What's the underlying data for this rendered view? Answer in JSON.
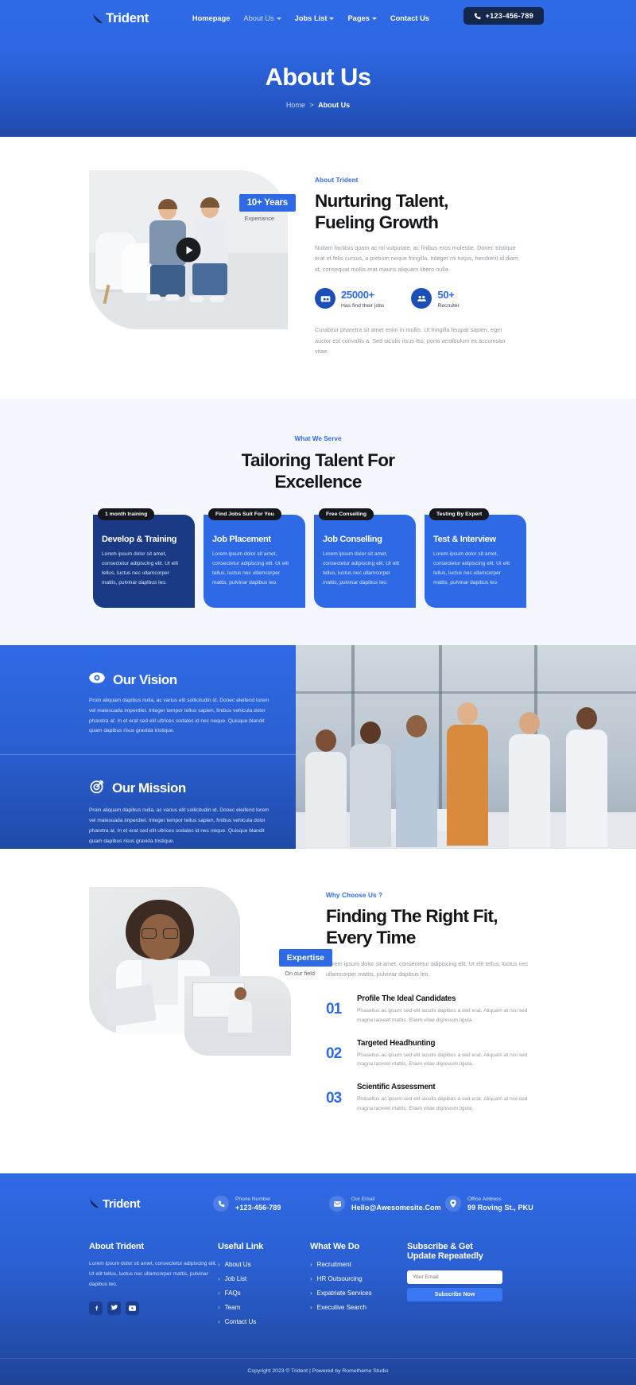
{
  "brand": {
    "name": "Trident"
  },
  "nav": {
    "items": [
      {
        "label": "Homepage",
        "caret": false,
        "active": true
      },
      {
        "label": "About Us",
        "caret": true,
        "active": false
      },
      {
        "label": "Jobs List",
        "caret": true,
        "active": false
      },
      {
        "label": "Pages",
        "caret": true,
        "active": false
      },
      {
        "label": "Contact Us",
        "caret": false,
        "active": false
      }
    ],
    "phone_button": "+123-456-789"
  },
  "hero": {
    "title": "About Us",
    "breadcrumb_home": "Home",
    "breadcrumb_sep": ">",
    "breadcrumb_current": "About Us"
  },
  "about": {
    "badge_years": "10+ Years",
    "badge_sub": "Experiance",
    "eyebrow": "About Trident",
    "title": "Nurturing Talent,\nFueling Growth",
    "paragraph": "Nullam facilisis quam ac mi vulputate, ac finibus eros molestie. Donec tristique erat et felis cursus, a pretium neque fringilla. Integer mi turpis, hendrerit id diam id, consequat mollis erat mauris aliquam libero nulla.",
    "stats": [
      {
        "number": "25000+",
        "label": "Has find their jobs",
        "icon": "handshake-icon"
      },
      {
        "number": "50+",
        "label": "Recruiter",
        "icon": "people-icon"
      }
    ],
    "paragraph2": "Curabitur pharetra sit amet enim in mollis. Ut fringilla feugiat sapien, eget auctor est convallis a. Sed iaculis risus leo, porta vestibulum ex accumsan vitae."
  },
  "serve": {
    "eyebrow": "What We Serve",
    "title": "Tailoring Talent For\nExcellence",
    "cards": [
      {
        "tag": "1 month training",
        "title": "Develop & Training",
        "body": "Lorem ipsum dolor sit amet, consectetur adipiscing elit. Ut elit tellus, luctus nec ullamcorper mattis, pulvinar dapibus leo."
      },
      {
        "tag": "Find Jobs Suit For You",
        "title": "Job Placement",
        "body": "Lorem ipsum dolor sit amet, consectetur adipiscing elit. Ut elit tellus, luctus nec ullamcorper mattis, pulvinar dapibus leo."
      },
      {
        "tag": "Free Conselling",
        "title": "Job Conselling",
        "body": "Lorem ipsum dolor sit amet, consectetur adipiscing elit. Ut elit tellus, luctus nec ullamcorper mattis, pulvinar dapibus leo."
      },
      {
        "tag": "Testing By Expert",
        "title": "Test & Interview",
        "body": "Lorem ipsum dolor sit amet, consectetur adipiscing elit. Ut elit tellus, luctus nec ullamcorper mattis, pulvinar dapibus leo."
      }
    ]
  },
  "vision_mission": {
    "vision": {
      "icon": "eye-icon",
      "title": "Our Vision",
      "body": "Proin aliquam dapibus nulla, ac varius elit sollicitudin id. Donec eleifend lorem vel malesuada imperdiet. Integer tempor tellus sapien, finibus vehicula dolor pharetra at. In et erat sed elit ultrices sodales id nec neque. Quisque blandit quam dapibus risus gravida tristique."
    },
    "mission": {
      "icon": "target-icon",
      "title": "Our Mission",
      "body": "Proin aliquam dapibus nulla, ac varius elit sollicitudin id. Donec eleifend lorem vel malesuada imperdiet. Integer tempor tellus sapien, finibus vehicula dolor pharetra at. In et erat sed elit ultrices sodales id nec neque. Quisque blandit quam dapibus risus gravida tristique."
    }
  },
  "why": {
    "badge": "Expertise",
    "badge_sub": "On our field",
    "eyebrow": "Why Choose Us ?",
    "title": "Finding The Right Fit,\nEvery Time",
    "paragraph": "Lorem ipsum dolor sit amet, consectetur adipiscing elit. Ut elit tellus, luctus nec ullamcorper mattis, pulvinar dapibus leo.",
    "steps": [
      {
        "num": "01",
        "title": "Profile The Ideal Candidates",
        "body": "Phasellus ac ipsum sed elit iaculis dapibus a sed erat. Aliquam at nisi sed magna laoreet mattis. Etiam vitae dignissim ligula."
      },
      {
        "num": "02",
        "title": "Targeted Headhunting",
        "body": "Phasellus ac ipsum sed elit iaculis dapibus a sed erat. Aliquam at nisi sed magna laoreet mattis. Etiam vitae dignissim ligula."
      },
      {
        "num": "03",
        "title": "Scientific Assessment",
        "body": "Phasellus ac ipsum sed elit iaculis dapibus a sed erat. Aliquam at nisi sed magna laoreet mattis. Etiam vitae dignissim ligula."
      }
    ]
  },
  "footer": {
    "brand": "Trident",
    "contacts": [
      {
        "icon": "phone-icon",
        "label": "Phone Number",
        "value": "+123-456-789"
      },
      {
        "icon": "mail-icon",
        "label": "Our Email",
        "value": "Hello@Awesomesite.Com"
      },
      {
        "icon": "location-icon",
        "label": "Office Address",
        "value": "99 Roving St., PKU"
      }
    ],
    "about": {
      "heading": "About Trident",
      "body": "Lorem ipsum dolor sit amet, consectetur adipiscing elit. Ut elit tellus, luctus nec ullamcorper mattis, pulvinar dapibus leo.",
      "socials": [
        "facebook-icon",
        "twitter-icon",
        "youtube-icon"
      ]
    },
    "useful": {
      "heading": "Useful Link",
      "items": [
        "About Us",
        "Job List",
        "FAQs",
        "Team",
        "Contact Us"
      ]
    },
    "whatwedo": {
      "heading": "What We Do",
      "items": [
        "Recruitment",
        "HR Outsourcing",
        "Expatriate Services",
        "Executive Search"
      ]
    },
    "subscribe": {
      "heading": "Subscribe & Get\nUpdate Repeatedly",
      "placeholder": "Your Email",
      "value": "",
      "button": "Subscribe Now"
    },
    "copyright": "Copyright 2023 © Trident | Powered by Rometheme Studio"
  },
  "colors": {
    "brand_blue": "#2f6ae6",
    "dark_navy": "#15264b",
    "deep_blue": "#1b3a85",
    "light_bg": "#f4f7fe"
  }
}
